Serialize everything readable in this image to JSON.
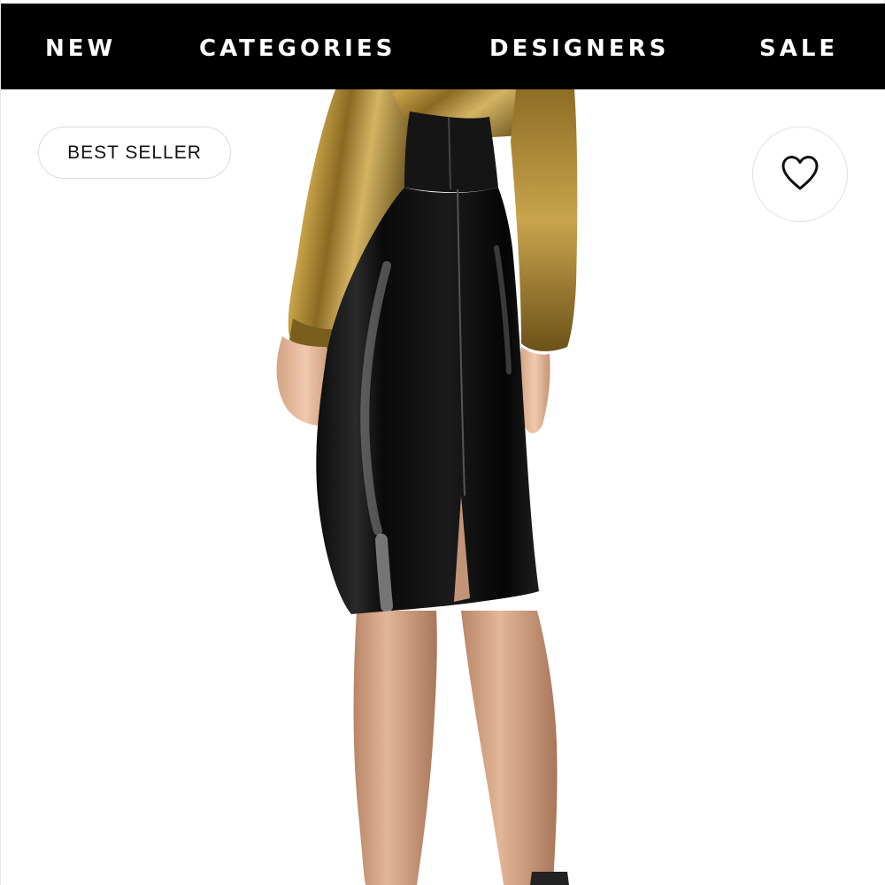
{
  "nav": {
    "items": [
      {
        "label": "NEW"
      },
      {
        "label": "CATEGORIES"
      },
      {
        "label": "DESIGNERS"
      },
      {
        "label": "SALE"
      }
    ]
  },
  "product": {
    "badge": "BEST SELLER",
    "favorite_icon": "heart-outline-icon"
  },
  "colors": {
    "nav_background": "#000000",
    "nav_text": "#ffffff",
    "page_background": "#ffffff"
  }
}
